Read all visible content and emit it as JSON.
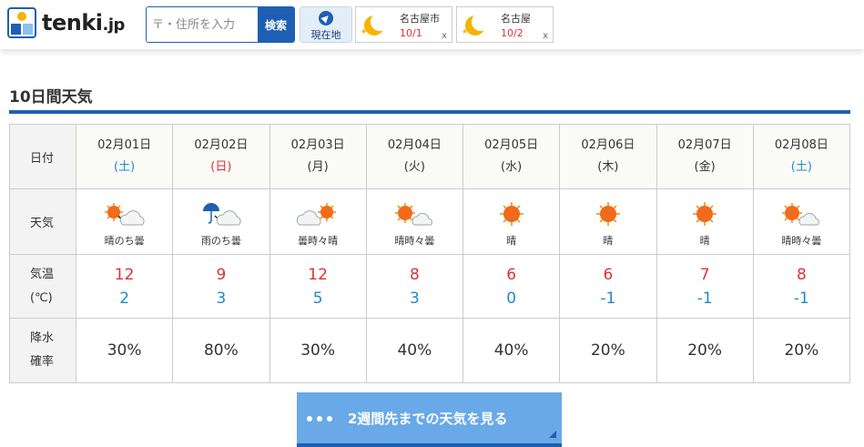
{
  "header": {
    "logo_text": "tenki",
    "logo_suffix": ".jp",
    "search_placeholder": "〒・住所を入力",
    "search_button": "検索",
    "location_button": "現在地",
    "history": [
      {
        "name": "名古屋市",
        "date": "10/1",
        "close": "x"
      },
      {
        "name": "名古屋",
        "date": "10/2",
        "close": "x"
      }
    ]
  },
  "section_title": "10日間天気",
  "table": {
    "row_labels": {
      "date": "日付",
      "weather": "天気",
      "temp_line1": "気温",
      "temp_line2": "(℃)",
      "rain_line1": "降水",
      "rain_line2": "確率"
    },
    "days": [
      {
        "date": "02月01日",
        "dow": "(土)",
        "dow_type": "sat",
        "icon": "sun-then-cloud",
        "weather": "晴のち曇",
        "high": "12",
        "low": "2",
        "rain": "30%"
      },
      {
        "date": "02月02日",
        "dow": "(日)",
        "dow_type": "sun",
        "icon": "rain-then-cloud",
        "weather": "雨のち曇",
        "high": "9",
        "low": "3",
        "rain": "80%"
      },
      {
        "date": "02月03日",
        "dow": "(月)",
        "dow_type": "weekday",
        "icon": "cloud-sometimes-sun",
        "weather": "曇時々晴",
        "high": "12",
        "low": "5",
        "rain": "30%"
      },
      {
        "date": "02月04日",
        "dow": "(火)",
        "dow_type": "weekday",
        "icon": "sun-sometimes-cloud",
        "weather": "晴時々曇",
        "high": "8",
        "low": "3",
        "rain": "40%"
      },
      {
        "date": "02月05日",
        "dow": "(水)",
        "dow_type": "weekday",
        "icon": "sun",
        "weather": "晴",
        "high": "6",
        "low": "0",
        "rain": "40%"
      },
      {
        "date": "02月06日",
        "dow": "(木)",
        "dow_type": "weekday",
        "icon": "sun",
        "weather": "晴",
        "high": "6",
        "low": "-1",
        "rain": "20%"
      },
      {
        "date": "02月07日",
        "dow": "(金)",
        "dow_type": "weekday",
        "icon": "sun",
        "weather": "晴",
        "high": "7",
        "low": "-1",
        "rain": "20%"
      },
      {
        "date": "02月08日",
        "dow": "(土)",
        "dow_type": "sat",
        "icon": "sun-sometimes-cloud",
        "weather": "晴時々曇",
        "high": "8",
        "low": "-1",
        "rain": "20%"
      }
    ]
  },
  "more_button": "2週間先までの天気を見る",
  "colors": {
    "brand": "#1e5fb4",
    "high_temp": "#dd3333",
    "low_temp": "#1e8acb",
    "button": "#6aa9e8"
  }
}
